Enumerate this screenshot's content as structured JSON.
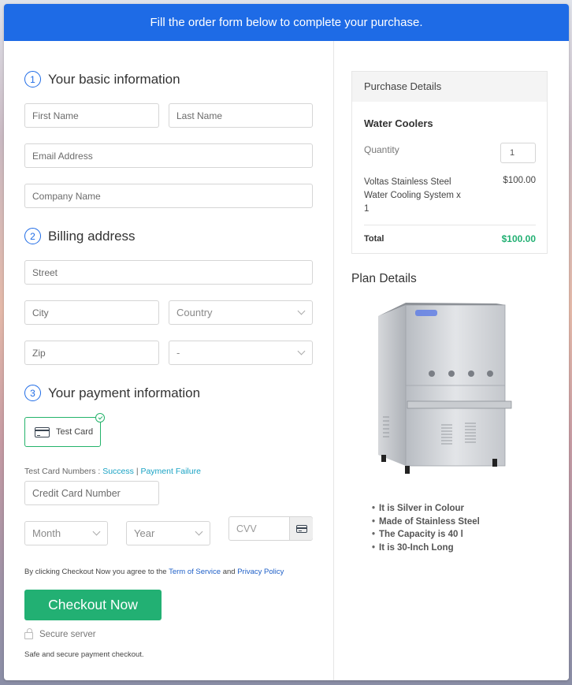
{
  "banner": {
    "text": "Fill the order form below to complete your purchase."
  },
  "sections": {
    "basic": {
      "number": "1",
      "title": "Your basic information"
    },
    "billing": {
      "number": "2",
      "title": "Billing address"
    },
    "payment": {
      "number": "3",
      "title": "Your payment information"
    }
  },
  "fields": {
    "first_name": {
      "placeholder": "First Name",
      "value": ""
    },
    "last_name": {
      "placeholder": "Last Name",
      "value": ""
    },
    "email": {
      "placeholder": "Email Address",
      "value": ""
    },
    "company": {
      "placeholder": "Company Name",
      "value": ""
    },
    "street": {
      "placeholder": "Street",
      "value": ""
    },
    "city": {
      "placeholder": "City",
      "value": ""
    },
    "country": {
      "selected": "Country"
    },
    "zip": {
      "placeholder": "Zip",
      "value": ""
    },
    "state": {
      "selected": "-"
    },
    "card_number": {
      "placeholder": "Credit Card Number",
      "value": ""
    },
    "month": {
      "selected": "Month"
    },
    "year": {
      "selected": "Year"
    },
    "cvv": {
      "placeholder": "CVV",
      "value": ""
    }
  },
  "payment": {
    "method_label": "Test Card",
    "test_numbers_label": "Test Card Numbers :",
    "success_link": "Success",
    "separator": "|",
    "failure_link": "Payment Failure"
  },
  "agreement": {
    "prefix": "By clicking Checkout Now you agree to the",
    "terms_link": "Term of Service",
    "and": "and",
    "privacy_link": "Privacy Policy"
  },
  "checkout_button": "Checkout Now",
  "secure_label": "Secure server",
  "safe_text": "Safe and secure payment checkout.",
  "purchase": {
    "header": "Purchase Details",
    "product_group": "Water Coolers",
    "quantity_label": "Quantity",
    "quantity_value": "1",
    "item_name": "Voltas Stainless Steel Water Cooling System x 1",
    "item_price": "$100.00",
    "total_label": "Total",
    "total_value": "$100.00"
  },
  "plan": {
    "title": "Plan Details",
    "image_alt": "stainless steel water cooler",
    "features": [
      "It is Silver in Colour",
      "Made of Stainless Steel",
      "The Capacity is 40 l",
      "It is 30-Inch Long"
    ]
  },
  "colors": {
    "brand_blue": "#1e6be6",
    "success_green": "#22b073",
    "link_teal": "#1aa3c4"
  }
}
